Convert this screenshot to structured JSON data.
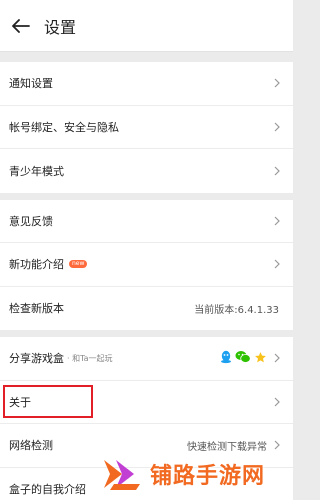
{
  "header": {
    "title": "设置"
  },
  "groups": [
    {
      "rows": [
        {
          "label": "通知设置"
        },
        {
          "label": "帐号绑定、安全与隐私"
        },
        {
          "label": "青少年模式"
        }
      ]
    },
    {
      "rows": [
        {
          "label": "意见反馈"
        },
        {
          "label": "新功能介绍",
          "badge": "new"
        },
        {
          "label": "检查新版本",
          "value": "当前版本:6.4.1.33"
        }
      ]
    },
    {
      "rows": [
        {
          "label": "分享游戏盒",
          "sub": "· 和Ta一起玩"
        },
        {
          "label": "关于"
        },
        {
          "label": "网络检测",
          "value": "快速检测下载异常"
        },
        {
          "label": "盒子的自我介绍"
        }
      ]
    }
  ],
  "share_icons": [
    "qq-icon",
    "wechat-icon",
    "qzone-star-icon"
  ],
  "colors": {
    "accent_red": "#e21e26",
    "badge": "#ff6a3d",
    "watermark": "#f26a21",
    "qq": "#1ea0f1",
    "wechat": "#2dc100",
    "star": "#f8c21d"
  },
  "watermark": {
    "text": "铺路手游网"
  }
}
